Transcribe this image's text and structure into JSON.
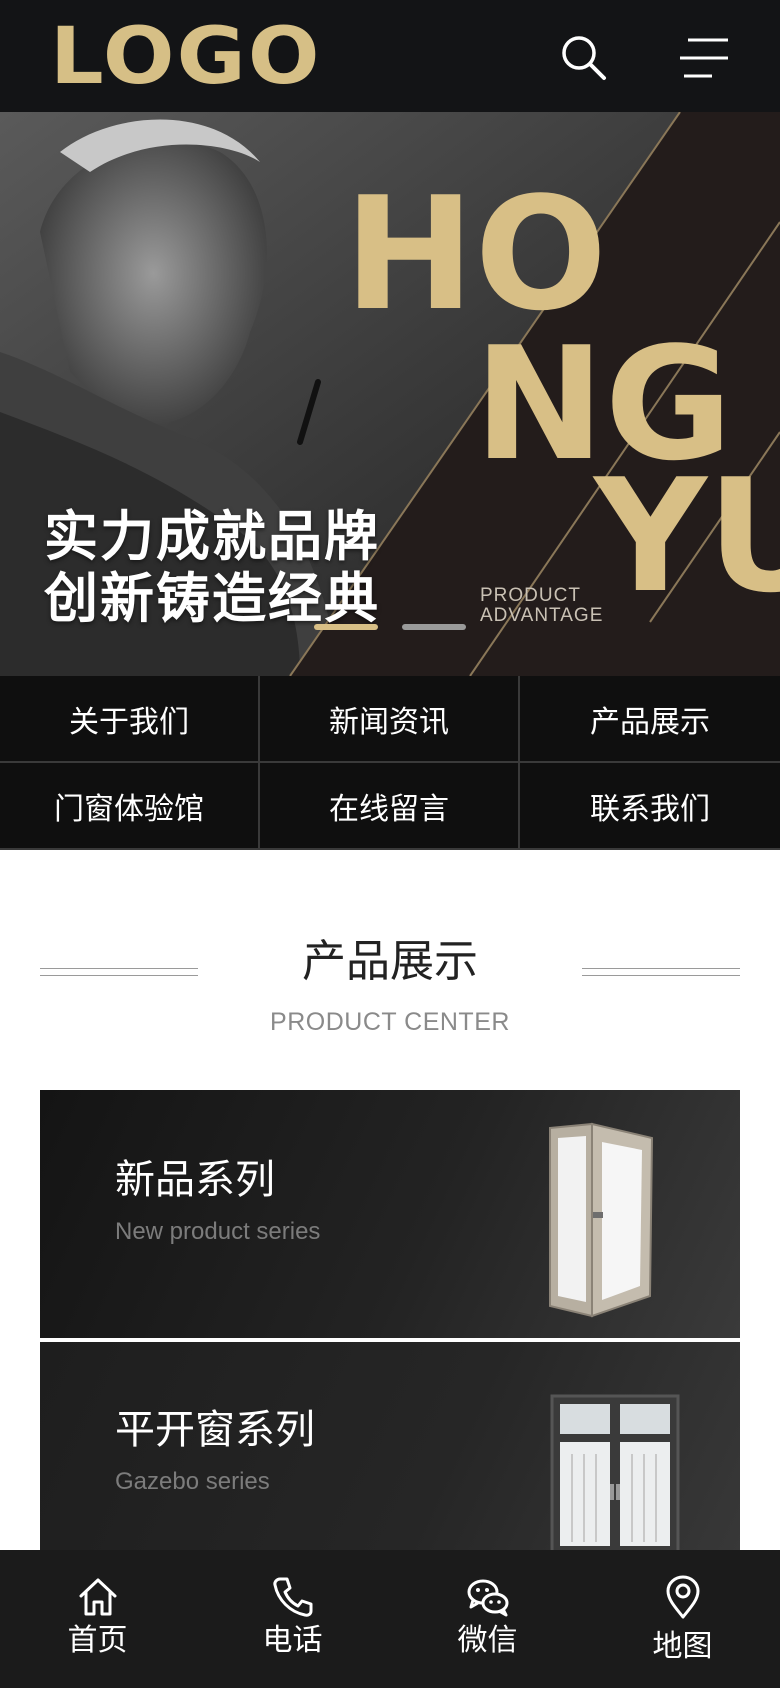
{
  "header": {
    "logo": "LOGO",
    "search_icon": "search-icon",
    "menu_icon": "menu-icon"
  },
  "banner": {
    "slogan_line1": "实力成就品牌",
    "slogan_line2": "创新铸造经典",
    "big_text": [
      "HO",
      "NG",
      "YU"
    ],
    "tagline_line1": "PRODUCT",
    "tagline_line2": "ADVANTAGE",
    "slide_count": 2,
    "active_slide": 1,
    "accent_color": "#d8bf86"
  },
  "nav": {
    "items": [
      {
        "label": "关于我们"
      },
      {
        "label": "新闻资讯"
      },
      {
        "label": "产品展示"
      },
      {
        "label": "门窗体验馆"
      },
      {
        "label": "在线留言"
      },
      {
        "label": "联系我们"
      }
    ]
  },
  "products": {
    "title": "产品展示",
    "subtitle": "PRODUCT CENTER",
    "cards": [
      {
        "title": "新品系列",
        "subtitle": "New product series"
      },
      {
        "title": "平开窗系列",
        "subtitle": "Gazebo series"
      }
    ]
  },
  "tabbar": {
    "items": [
      {
        "label": "首页",
        "icon": "home-icon"
      },
      {
        "label": "电话",
        "icon": "phone-icon"
      },
      {
        "label": "微信",
        "icon": "wechat-icon"
      },
      {
        "label": "地图",
        "icon": "map-pin-icon"
      }
    ]
  }
}
